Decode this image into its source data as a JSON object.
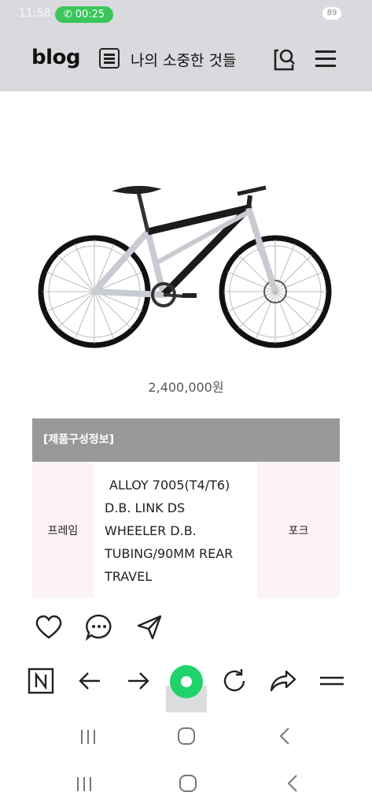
{
  "status_bar": {
    "time": "11:58",
    "call_duration": "00:25",
    "battery": "89"
  },
  "header": {
    "logo": "blog",
    "blog_name": "나의 소중한 것들"
  },
  "post": {
    "price": "2,400,000원",
    "spec_table": {
      "header": "[제품구성정보]",
      "rows": [
        {
          "label": "프레임",
          "value_lines": [
            "ALLOY 7005(T4/T6)",
            "D.B. LINK DS",
            "WHEELER D.B.",
            "TUBING/90MM REAR",
            "TRAVEL"
          ],
          "next_label": "포크"
        }
      ]
    }
  },
  "reactions": {
    "icons": [
      "heart-icon",
      "comment-icon",
      "share-icon"
    ]
  },
  "browser_toolbar": {
    "icons": [
      "naver-n-icon",
      "back-arrow-icon",
      "forward-arrow-icon",
      "green-dot-icon",
      "refresh-icon",
      "share-arrow-icon",
      "menu-lines-icon"
    ]
  },
  "colors": {
    "header_bg": "#d9dadd",
    "table_header_bg": "#999999",
    "table_label_bg": "#fdf2f5",
    "call_pill": "#39c55a",
    "green_button": "#1fd26a"
  }
}
